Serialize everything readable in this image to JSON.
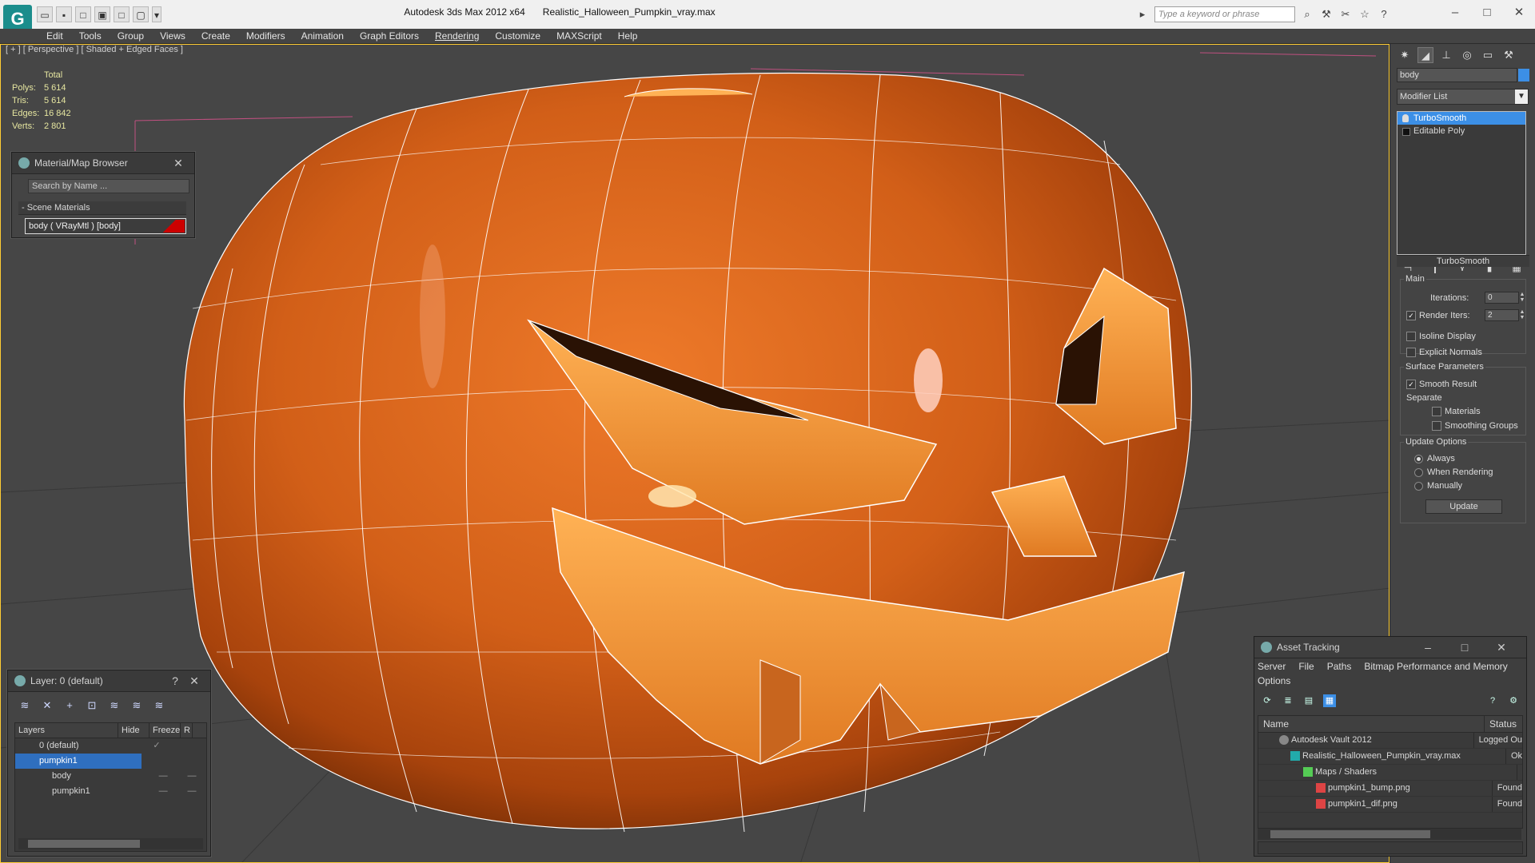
{
  "app": {
    "title": "Autodesk 3ds Max  2012 x64",
    "file": "Realistic_Halloween_Pumpkin_vray.max",
    "logo": "3ds-max-logo",
    "search_placeholder": "Type a keyword or phrase"
  },
  "menu": [
    "Edit",
    "Tools",
    "Group",
    "Views",
    "Create",
    "Modifiers",
    "Animation",
    "Graph Editors",
    "Rendering",
    "Customize",
    "MAXScript",
    "Help"
  ],
  "viewport": {
    "label": "[ + ] [ Perspective ] [ Shaded + Edged Faces ]",
    "stats": {
      "header": "Total",
      "rows": [
        {
          "k": "Polys:",
          "v": "5 614"
        },
        {
          "k": "Tris:",
          "v": "5 614"
        },
        {
          "k": "Edges:",
          "v": "16 842"
        },
        {
          "k": "Verts:",
          "v": "2 801"
        }
      ]
    }
  },
  "material_browser": {
    "title": "Material/Map Browser",
    "search": "Search by Name ...",
    "category": "- Scene Materials",
    "item": "body  ( VRayMtl ) [body]"
  },
  "layers": {
    "title": "Layer: 0 (default)",
    "help": "?",
    "close": "✕",
    "columns": [
      "Layers",
      "Hide",
      "Freeze",
      "R"
    ],
    "rows": [
      {
        "name": "0 (default)",
        "hide": "✓",
        "freeze": "",
        "sel": false
      },
      {
        "name": "pumpkin1",
        "hide": "",
        "freeze": "",
        "sel": true
      },
      {
        "name": "body",
        "hide": "—",
        "freeze": "—",
        "sel": false
      },
      {
        "name": "pumpkin1",
        "hide": "—",
        "freeze": "—",
        "sel": false
      }
    ]
  },
  "command_panel": {
    "object_name": "body",
    "object_color": "#3c8fe6",
    "modifier_list": "Modifier List",
    "stack": [
      "TurboSmooth",
      "Editable Poly"
    ],
    "rollout_title": "TurboSmooth",
    "main_group": "Main",
    "iterations_label": "Iterations:",
    "iterations_value": "0",
    "render_iters_label": "Render Iters:",
    "render_iters_value": "2",
    "isoline": "Isoline Display",
    "explicit_normals": "Explicit Normals",
    "surface_group": "Surface Parameters",
    "smooth_result": "Smooth Result",
    "separate": "Separate",
    "materials": "Materials",
    "smoothing_groups": "Smoothing Groups",
    "update_group": "Update Options",
    "always": "Always",
    "when_rendering": "When Rendering",
    "manually": "Manually",
    "update_button": "Update"
  },
  "asset_tracking": {
    "title": "Asset Tracking",
    "menu1": [
      "Server",
      "File",
      "Paths",
      "Bitmap Performance and Memory"
    ],
    "menu2": [
      "Options"
    ],
    "col_name": "Name",
    "col_status": "Status",
    "rows": [
      {
        "name": "Autodesk Vault 2012",
        "status": "Logged Ou",
        "indent": 1,
        "icon": "vault-icon"
      },
      {
        "name": "Realistic_Halloween_Pumpkin_vray.max",
        "status": "Ok",
        "indent": 2,
        "icon": "max-file-icon"
      },
      {
        "name": "Maps / Shaders",
        "status": "",
        "indent": 3,
        "icon": "maps-icon"
      },
      {
        "name": "pumpkin1_bump.png",
        "status": "Found",
        "indent": 4,
        "icon": "png-icon"
      },
      {
        "name": "pumpkin1_dif.png",
        "status": "Found",
        "indent": 4,
        "icon": "png-icon"
      }
    ]
  },
  "colors": {
    "pumpkin": "#d8641a",
    "pumpkin_light": "#f08a3a",
    "pumpkin_dark": "#8a3508",
    "selection": "#3c8fe6"
  }
}
